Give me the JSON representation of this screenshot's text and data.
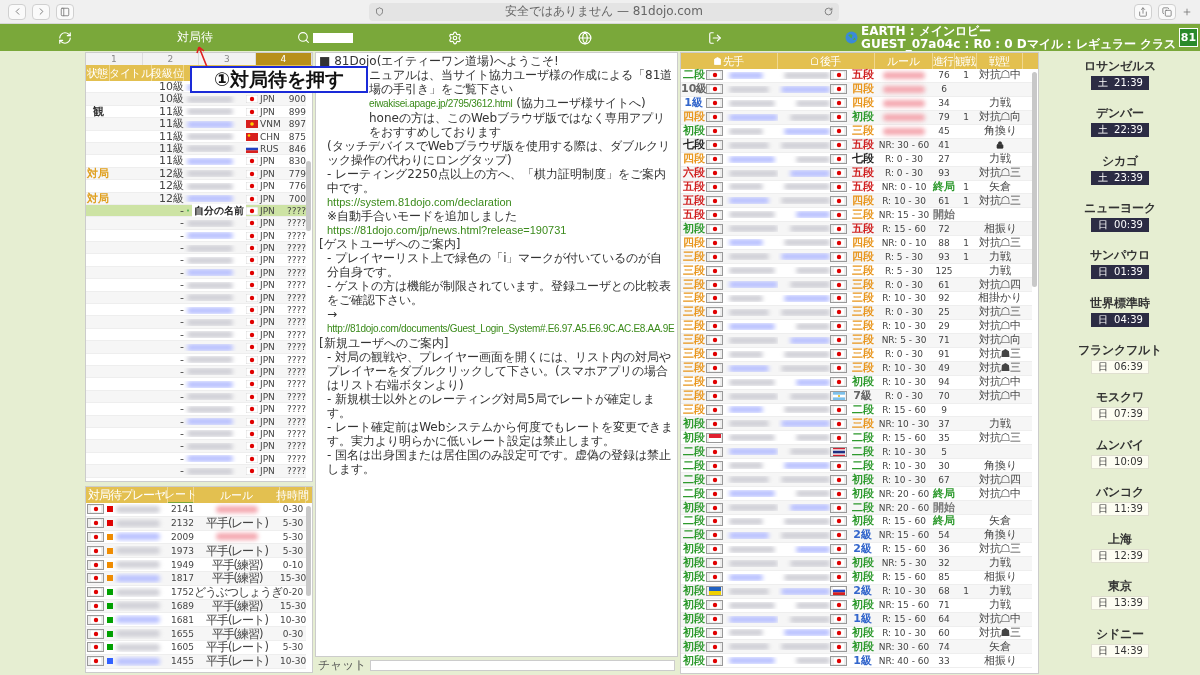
{
  "browser": {
    "address": "安全ではありません — 81dojo.com"
  },
  "nav": {
    "wait_label": "対局待",
    "lobby": "EARTH : メインロビー",
    "user": "GUEST_07a04c : R0 : 0 Dマイル : レギュラー クラス",
    "logo": "81"
  },
  "callout": {
    "text": "①対局待を押す"
  },
  "players": {
    "tabs": [
      {
        "label": "1",
        "selected": false
      },
      {
        "label": "2",
        "selected": false
      },
      {
        "label": "3",
        "selected": false
      },
      {
        "label": "4",
        "selected": true
      }
    ],
    "columns": [
      "状態",
      "タイトル",
      "段級位"
    ],
    "rows": [
      {
        "rank": "10級",
        "selected": false
      },
      {
        "rank": "10級",
        "flag": {
          "kind": "jp"
        },
        "country": "JPN",
        "rate": "900",
        "selected": false
      },
      {
        "status": {
          "text": "観",
          "color": "#333333"
        },
        "rank": "11級",
        "flag": {
          "kind": "jp"
        },
        "country": "JPN",
        "rate": "899",
        "selected": false
      },
      {
        "rank": "11級",
        "flag": {
          "kind": "vn"
        },
        "country": "VNM",
        "rate": "897",
        "selected": false
      },
      {
        "rank": "11級",
        "flag": {
          "kind": "cn"
        },
        "country": "CHN",
        "rate": "875",
        "selected": false
      },
      {
        "rank": "11級",
        "flag": {
          "kind": "ru"
        },
        "country": "RUS",
        "rate": "846",
        "selected": false
      },
      {
        "rank": "11級",
        "flag": {
          "kind": "jp"
        },
        "country": "JPN",
        "rate": "830",
        "selected": false
      },
      {
        "status": {
          "text": "対局",
          "color": "#e0a020"
        },
        "rank": "12級",
        "flag": {
          "kind": "jp"
        },
        "country": "JPN",
        "rate": "779",
        "selected": false
      },
      {
        "rank": "12級",
        "flag": {
          "kind": "jp"
        },
        "country": "JPN",
        "rate": "776",
        "selected": false
      },
      {
        "status": {
          "text": "対局",
          "color": "#e0a020"
        },
        "rank": "12級",
        "flag": {
          "kind": "jp"
        },
        "country": "JPN",
        "rate": "700",
        "selected": false
      },
      {
        "rank": "-",
        "name": "自分の名前",
        "flag": {
          "kind": "jp"
        },
        "country": "JPN",
        "rate": "????",
        "selected": true
      },
      {
        "rank": "-",
        "flag": {
          "kind": "jp"
        },
        "country": "JPN",
        "rate": "????",
        "selected": false
      },
      {
        "rank": "-",
        "flag": {
          "kind": "jp"
        },
        "country": "JPN",
        "rate": "????",
        "selected": false
      },
      {
        "rank": "-",
        "flag": {
          "kind": "jp"
        },
        "country": "JPN",
        "rate": "????",
        "selected": false
      },
      {
        "rank": "-",
        "flag": {
          "kind": "jp"
        },
        "country": "JPN",
        "rate": "????",
        "selected": false
      },
      {
        "rank": "-",
        "flag": {
          "kind": "jp"
        },
        "country": "JPN",
        "rate": "????",
        "selected": false
      },
      {
        "rank": "-",
        "flag": {
          "kind": "jp"
        },
        "country": "JPN",
        "rate": "????",
        "selected": false
      },
      {
        "rank": "-",
        "flag": {
          "kind": "jp"
        },
        "country": "JPN",
        "rate": "????",
        "selected": false
      },
      {
        "rank": "-",
        "flag": {
          "kind": "jp"
        },
        "country": "JPN",
        "rate": "????",
        "selected": false
      },
      {
        "rank": "-",
        "flag": {
          "kind": "jp"
        },
        "country": "JPN",
        "rate": "????",
        "selected": false
      },
      {
        "rank": "-",
        "flag": {
          "kind": "jp"
        },
        "country": "JPN",
        "rate": "????",
        "selected": false
      },
      {
        "rank": "-",
        "flag": {
          "kind": "jp"
        },
        "country": "JPN",
        "rate": "????",
        "selected": false
      },
      {
        "rank": "-",
        "flag": {
          "kind": "jp"
        },
        "country": "JPN",
        "rate": "????",
        "selected": false
      },
      {
        "rank": "-",
        "flag": {
          "kind": "jp"
        },
        "country": "JPN",
        "rate": "????",
        "selected": false
      },
      {
        "rank": "-",
        "flag": {
          "kind": "jp"
        },
        "country": "JPN",
        "rate": "????",
        "selected": false
      },
      {
        "rank": "-",
        "flag": {
          "kind": "jp"
        },
        "country": "JPN",
        "rate": "????",
        "selected": false
      },
      {
        "rank": "-",
        "flag": {
          "kind": "jp"
        },
        "country": "JPN",
        "rate": "????",
        "selected": false
      },
      {
        "rank": "-",
        "flag": {
          "kind": "jp"
        },
        "country": "JPN",
        "rate": "????",
        "selected": false
      },
      {
        "rank": "-",
        "flag": {
          "kind": "jp"
        },
        "country": "JPN",
        "rate": "????",
        "selected": false
      },
      {
        "rank": "-",
        "flag": {
          "kind": "jp"
        },
        "country": "JPN",
        "rate": "????",
        "selected": false
      },
      {
        "rank": "-",
        "flag": {
          "kind": "jp"
        },
        "country": "JPN",
        "rate": "????",
        "selected": false
      },
      {
        "rank": "-",
        "flag": {
          "kind": "jp"
        },
        "country": "JPN",
        "rate": "????",
        "selected": false
      }
    ]
  },
  "waiting": {
    "columns": [
      {
        "label": "対局待プレーヤ",
        "selected": false
      },
      {
        "label": "レート",
        "selected": true
      },
      {
        "label": "ルール",
        "selected": false
      },
      {
        "label": "持時間",
        "selected": false
      }
    ],
    "rows": [
      {
        "color": "#e00000",
        "rate": "2141",
        "rule_hidden": true,
        "time": "0-30"
      },
      {
        "color": "#e00000",
        "rate": "2132",
        "rule": "平手(レート)",
        "time": "5-30"
      },
      {
        "color": "#f08c00",
        "rate": "2009",
        "rule_hidden": true,
        "time": "5-30"
      },
      {
        "color": "#f08c00",
        "rate": "1973",
        "rule": "平手(レート)",
        "time": "5-30"
      },
      {
        "color": "#f08c00",
        "rate": "1949",
        "rule": "平手(練習)",
        "time": "0-10"
      },
      {
        "color": "#f08c00",
        "rate": "1817",
        "rule": "平手(練習)",
        "time": "15-30"
      },
      {
        "color": "#00a000",
        "rate": "1752",
        "rule": "どうぶつしょうぎ",
        "time": "0-20"
      },
      {
        "color": "#00a000",
        "rate": "1689",
        "rule": "平手(練習)",
        "time": "15-30"
      },
      {
        "color": "#00a000",
        "rate": "1681",
        "rule": "平手(レート)",
        "time": "10-30"
      },
      {
        "color": "#00a000",
        "rate": "1655",
        "rule": "平手(練習)",
        "time": "0-30"
      },
      {
        "color": "#00a000",
        "rate": "1605",
        "rule": "平手(レート)",
        "time": "5-30"
      },
      {
        "color": "#3060ff",
        "rate": "1455",
        "rule": "平手(レート)",
        "time": "10-30"
      }
    ]
  },
  "notice": {
    "lines": [
      {
        "kind": "full",
        "parts": [
          {
            "kind": "text",
            "text": "■ 81Dojo(エイティーワン道場)へようこそ!"
          }
        ]
      },
      {
        "kind": "partial",
        "parts": [
          {
            "kind": "text",
            "text": "ニュアルは、当サイト協力ユーザ様の作成による「81道場の手引き」をご覧下さい"
          }
        ]
      },
      {
        "kind": "partial",
        "parts": [
          {
            "kind": "link",
            "text": "eiwakisei.apage.jp/2795/3612.html"
          },
          {
            "kind": "text",
            "text": " (協力ユーザ様サイトへ)"
          }
        ]
      },
      {
        "kind": "partial",
        "parts": [
          {
            "kind": "text",
            "text": "honeの方は、このWebブラウザ版ではなく専用アプリをおすすめしております"
          }
        ]
      },
      {
        "kind": "indent",
        "parts": [
          {
            "kind": "text",
            "text": "(タッチデバイスでWebブラウザ版を使用する際は、ダブルクリック操作の代わりにロングタップ)"
          }
        ]
      },
      {
        "kind": "indent",
        "parts": [
          {
            "kind": "text",
            "text": "- レーティング2250点以上の方へ、「棋力証明制度」をご案内中です。"
          }
        ]
      },
      {
        "kind": "indent",
        "parts": [
          {
            "kind": "link",
            "text": "https://system.81dojo.com/declaration"
          }
        ]
      },
      {
        "kind": "indent",
        "parts": [
          {
            "kind": "text",
            "text": "※自動手合いモードを追加しました"
          }
        ]
      },
      {
        "kind": "indent",
        "parts": [
          {
            "kind": "link",
            "text": "https://81dojo.com/jp/news.html?release=190731"
          }
        ]
      },
      {
        "kind": "full",
        "parts": [
          {
            "kind": "text",
            "text": "[ゲストユーザへのご案内]"
          }
        ]
      },
      {
        "kind": "indent",
        "parts": [
          {
            "kind": "text",
            "text": "- プレイヤーリスト上で緑色の「i」マークが付いているのが自分自身です。"
          }
        ]
      },
      {
        "kind": "indent",
        "parts": [
          {
            "kind": "text",
            "text": "- ゲストの方は機能が制限されています。登録ユーザとの比較表をご確認下さい。"
          }
        ]
      },
      {
        "kind": "indent",
        "parts": [
          {
            "kind": "text",
            "text": "→ "
          },
          {
            "kind": "link",
            "text": "http://81dojo.com/documents/Guest_Login_System#.E6.97.A5.E6.9C.AC.E8.AA.9E"
          }
        ]
      },
      {
        "kind": "full",
        "parts": [
          {
            "kind": "text",
            "text": "[新規ユーザへのご案内]"
          }
        ]
      },
      {
        "kind": "indent",
        "parts": [
          {
            "kind": "text",
            "text": "- 対局の観戦や、プレイヤー画面を開くには、リスト内の対局やプレイヤーをダブルクリックして下さい。(スマホアプリの場合はリスト右端ボタンより)"
          }
        ]
      },
      {
        "kind": "indent",
        "parts": [
          {
            "kind": "text",
            "text": "- 新規棋士以外とのレーティング対局5局でレートが確定します。"
          }
        ]
      },
      {
        "kind": "indent",
        "parts": [
          {
            "kind": "text",
            "text": "- レート確定前はWebシステムから何度でもレートを変更できます。実力より明らかに低いレート設定は禁止します。"
          }
        ]
      },
      {
        "kind": "indent",
        "parts": [
          {
            "kind": "text",
            "text": "- 国名は出身国または居住国のみ設定可です。虚偽の登録は禁止します。"
          }
        ]
      }
    ],
    "chat_label": "チャット"
  },
  "games": {
    "columns": [
      "先手",
      "後手",
      "ルール",
      "進行",
      "観戦",
      "戦型"
    ],
    "rows": [
      {
        "black": {
          "rank": "二段",
          "color": "#2e9a2e"
        },
        "white": {
          "rank": "五段",
          "color": "#d02020"
        },
        "rule_hidden": true,
        "moves": "76",
        "watchers": "1",
        "opening": "対抗☖中"
      },
      {
        "black": {
          "rank": "10級",
          "color": "#666666"
        },
        "white": {
          "rank": "四段",
          "color": "#e8961e"
        },
        "rule_hidden": true,
        "moves": "6"
      },
      {
        "black": {
          "rank": "1級",
          "color": "#3366cc"
        },
        "white": {
          "rank": "四段",
          "color": "#e8961e"
        },
        "rule_hidden": true,
        "moves": "34",
        "opening": "力戦"
      },
      {
        "black": {
          "rank": "四段",
          "color": "#e8961e"
        },
        "white": {
          "rank": "初段",
          "color": "#2e9a2e"
        },
        "rule_hidden": true,
        "moves": "79",
        "watchers": "1",
        "opening": "対抗☖向"
      },
      {
        "black": {
          "rank": "初段",
          "color": "#2e9a2e"
        },
        "white": {
          "rank": "三段",
          "color": "#e8961e"
        },
        "rule_hidden": true,
        "moves": "45",
        "opening": "角換り"
      },
      {
        "black": {
          "rank": "七段",
          "color": "#222222"
        },
        "white": {
          "rank": "五段",
          "color": "#d02020"
        },
        "rule": "NR: 30 - 60",
        "moves": "41",
        "locked": true
      },
      {
        "black": {
          "rank": "四段",
          "color": "#e8961e"
        },
        "white": {
          "rank": "七段",
          "color": "#222222"
        },
        "rule": "R: 0 - 30",
        "moves": "27",
        "opening": "力戦"
      },
      {
        "black": {
          "rank": "六段",
          "color": "#d02020"
        },
        "white": {
          "rank": "五段",
          "color": "#d02020"
        },
        "rule": "R: 0 - 30",
        "moves": "93",
        "opening": "対抗☖三"
      },
      {
        "black": {
          "rank": "五段",
          "color": "#d02020"
        },
        "white": {
          "rank": "五段",
          "color": "#d02020"
        },
        "rule": "NR: 0 - 10",
        "moves": {
          "text": "終局",
          "color": "#2e9a2e"
        },
        "watchers": "1",
        "opening": "矢倉"
      },
      {
        "black": {
          "rank": "五段",
          "color": "#d02020"
        },
        "white": {
          "rank": "四段",
          "color": "#e8961e"
        },
        "rule": "R: 10 - 30",
        "moves": "61",
        "watchers": "1",
        "opening": "対抗☖三"
      },
      {
        "black": {
          "rank": "五段",
          "color": "#d02020"
        },
        "white": {
          "rank": "三段",
          "color": "#e8961e"
        },
        "rule": "NR: 15 - 30",
        "moves": {
          "text": "開始",
          "color": "#777777"
        }
      },
      {
        "black": {
          "rank": "初段",
          "color": "#2e9a2e"
        },
        "white": {
          "rank": "五段",
          "color": "#d02020"
        },
        "rule": "R: 15 - 60",
        "moves": "72",
        "opening": "相振り"
      },
      {
        "black": {
          "rank": "四段",
          "color": "#e8961e"
        },
        "white": {
          "rank": "四段",
          "color": "#e8961e"
        },
        "rule": "NR: 0 - 10",
        "moves": "88",
        "watchers": "1",
        "opening": "対抗☖三"
      },
      {
        "black": {
          "rank": "三段",
          "color": "#e8961e"
        },
        "white": {
          "rank": "四段",
          "color": "#e8961e"
        },
        "rule": "R: 5 - 30",
        "moves": "93",
        "watchers": "1",
        "opening": "力戦"
      },
      {
        "black": {
          "rank": "三段",
          "color": "#e8961e"
        },
        "white": {
          "rank": "三段",
          "color": "#e8961e"
        },
        "rule": "R: 5 - 30",
        "moves": "125",
        "opening": "力戦"
      },
      {
        "black": {
          "rank": "三段",
          "color": "#e8961e"
        },
        "white": {
          "rank": "三段",
          "color": "#e8961e"
        },
        "rule": "R: 0 - 30",
        "moves": "61",
        "opening": "対抗☖四"
      },
      {
        "black": {
          "rank": "三段",
          "color": "#e8961e"
        },
        "white": {
          "rank": "三段",
          "color": "#e8961e"
        },
        "rule": "R: 10 - 30",
        "moves": "92",
        "opening": "相掛かり"
      },
      {
        "black": {
          "rank": "三段",
          "color": "#e8961e"
        },
        "white": {
          "rank": "三段",
          "color": "#e8961e"
        },
        "rule": "R: 0 - 30",
        "moves": "25",
        "opening": "対抗☖三"
      },
      {
        "black": {
          "rank": "三段",
          "color": "#e8961e"
        },
        "white": {
          "rank": "三段",
          "color": "#e8961e"
        },
        "rule": "R: 10 - 30",
        "moves": "29",
        "opening": "対抗☖中"
      },
      {
        "black": {
          "rank": "三段",
          "color": "#e8961e"
        },
        "white": {
          "rank": "三段",
          "color": "#e8961e"
        },
        "rule": "NR: 5 - 30",
        "moves": "71",
        "opening": "対抗☖向"
      },
      {
        "black": {
          "rank": "三段",
          "color": "#e8961e"
        },
        "white": {
          "rank": "三段",
          "color": "#e8961e"
        },
        "rule": "R: 0 - 30",
        "moves": "91",
        "opening": "対抗☗三"
      },
      {
        "black": {
          "rank": "三段",
          "color": "#e8961e"
        },
        "white": {
          "rank": "三段",
          "color": "#e8961e"
        },
        "rule": "R: 10 - 30",
        "moves": "49",
        "opening": "対抗☗三"
      },
      {
        "black": {
          "rank": "三段",
          "color": "#e8961e"
        },
        "white": {
          "rank": "初段",
          "color": "#2e9a2e"
        },
        "rule": "R: 10 - 30",
        "moves": "94",
        "opening": "対抗☖中"
      },
      {
        "black": {
          "rank": "三段",
          "color": "#e8961e"
        },
        "white": {
          "rank": "7級",
          "color": "#666666",
          "flag": {
            "kind": "ar"
          }
        },
        "rule": "R: 0 - 30",
        "moves": "70",
        "opening": "対抗☖中"
      },
      {
        "black": {
          "rank": "三段",
          "color": "#e8961e"
        },
        "white": {
          "rank": "二段",
          "color": "#2e9a2e"
        },
        "rule": "R: 15 - 60",
        "moves": "9"
      },
      {
        "black": {
          "rank": "初段",
          "color": "#2e9a2e"
        },
        "white": {
          "rank": "三段",
          "color": "#e8961e"
        },
        "rule": "NR: 10 - 30",
        "moves": "37",
        "opening": "力戦"
      },
      {
        "black": {
          "rank": "初段",
          "color": "#2e9a2e",
          "flag": {
            "kind": "sg"
          }
        },
        "white": {
          "rank": "二段",
          "color": "#2e9a2e"
        },
        "rule": "R: 15 - 60",
        "moves": "35",
        "opening": "対抗☖三"
      },
      {
        "black": {
          "rank": "二段",
          "color": "#2e9a2e"
        },
        "white": {
          "rank": "二段",
          "color": "#2e9a2e",
          "flag": {
            "kind": "th"
          }
        },
        "rule": "R: 10 - 30",
        "moves": "5"
      },
      {
        "black": {
          "rank": "二段",
          "color": "#2e9a2e"
        },
        "white": {
          "rank": "二段",
          "color": "#2e9a2e"
        },
        "rule": "R: 10 - 30",
        "moves": "30",
        "opening": "角換り"
      },
      {
        "black": {
          "rank": "二段",
          "color": "#2e9a2e"
        },
        "white": {
          "rank": "初段",
          "color": "#2e9a2e"
        },
        "rule": "R: 10 - 30",
        "moves": "67",
        "opening": "対抗☖四"
      },
      {
        "black": {
          "rank": "二段",
          "color": "#2e9a2e"
        },
        "white": {
          "rank": "初段",
          "color": "#2e9a2e"
        },
        "rule": "NR: 20 - 60",
        "moves": {
          "text": "終局",
          "color": "#2e9a2e"
        },
        "opening": "対抗☖中"
      },
      {
        "black": {
          "rank": "初段",
          "color": "#2e9a2e"
        },
        "white": {
          "rank": "二段",
          "color": "#2e9a2e"
        },
        "rule": "NR: 20 - 60",
        "moves": {
          "text": "開始",
          "color": "#777777"
        }
      },
      {
        "black": {
          "rank": "二段",
          "color": "#2e9a2e"
        },
        "white": {
          "rank": "初段",
          "color": "#2e9a2e"
        },
        "rule": "R: 15 - 60",
        "moves": {
          "text": "終局",
          "color": "#2e9a2e"
        },
        "opening": "矢倉"
      },
      {
        "black": {
          "rank": "二段",
          "color": "#2e9a2e"
        },
        "white": {
          "rank": "2級",
          "color": "#3366cc"
        },
        "rule": "NR: 15 - 60",
        "moves": "54",
        "opening": "角換り"
      },
      {
        "black": {
          "rank": "初段",
          "color": "#2e9a2e"
        },
        "white": {
          "rank": "2級",
          "color": "#3366cc"
        },
        "rule": "R: 15 - 60",
        "moves": "36",
        "opening": "対抗☖三"
      },
      {
        "black": {
          "rank": "初段",
          "color": "#2e9a2e"
        },
        "white": {
          "rank": "初段",
          "color": "#2e9a2e"
        },
        "rule": "NR: 5 - 30",
        "moves": "32",
        "opening": "力戦"
      },
      {
        "black": {
          "rank": "初段",
          "color": "#2e9a2e"
        },
        "white": {
          "rank": "初段",
          "color": "#2e9a2e"
        },
        "rule": "R: 15 - 60",
        "moves": "85",
        "opening": "相振り"
      },
      {
        "black": {
          "rank": "初段",
          "color": "#2e9a2e",
          "flag": {
            "kind": "ua"
          }
        },
        "white": {
          "rank": "2級",
          "color": "#3366cc",
          "flag": {
            "kind": "ru"
          }
        },
        "rule": "R: 10 - 30",
        "moves": "68",
        "watchers": "1",
        "opening": "力戦"
      },
      {
        "black": {
          "rank": "初段",
          "color": "#2e9a2e"
        },
        "white": {
          "rank": "初段",
          "color": "#2e9a2e"
        },
        "rule": "NR: 15 - 60",
        "moves": "71",
        "opening": "力戦"
      },
      {
        "black": {
          "rank": "初段",
          "color": "#2e9a2e"
        },
        "white": {
          "rank": "1級",
          "color": "#3366cc"
        },
        "rule": "R: 15 - 60",
        "moves": "64",
        "opening": "対抗☖中"
      },
      {
        "black": {
          "rank": "初段",
          "color": "#2e9a2e"
        },
        "white": {
          "rank": "初段",
          "color": "#2e9a2e"
        },
        "rule": "R: 10 - 30",
        "moves": "60",
        "opening": "対抗☗三"
      },
      {
        "black": {
          "rank": "初段",
          "color": "#2e9a2e"
        },
        "white": {
          "rank": "初段",
          "color": "#2e9a2e"
        },
        "rule": "NR: 30 - 60",
        "moves": "74",
        "opening": "矢倉"
      },
      {
        "black": {
          "rank": "初段",
          "color": "#2e9a2e"
        },
        "white": {
          "rank": "1級",
          "color": "#3366cc"
        },
        "rule": "NR: 40 - 60",
        "moves": "33",
        "opening": "相振り"
      }
    ]
  },
  "clocks": [
    {
      "city": "ロサンゼルス",
      "day": "土",
      "time": "21:39",
      "night": true
    },
    {
      "city": "デンバー",
      "day": "土",
      "time": "22:39",
      "night": true
    },
    {
      "city": "シカゴ",
      "day": "土",
      "time": "23:39",
      "night": true
    },
    {
      "city": "ニューヨーク",
      "day": "日",
      "time": "00:39",
      "night": true
    },
    {
      "city": "サンパウロ",
      "day": "日",
      "time": "01:39",
      "night": true
    },
    {
      "city": "世界標準時",
      "day": "日",
      "time": "04:39",
      "night": true
    },
    {
      "city": "フランクフルト",
      "day": "日",
      "time": "06:39",
      "night": false
    },
    {
      "city": "モスクワ",
      "day": "日",
      "time": "07:39",
      "night": false
    },
    {
      "city": "ムンバイ",
      "day": "日",
      "time": "10:09",
      "night": false
    },
    {
      "city": "バンコク",
      "day": "日",
      "time": "11:39",
      "night": false
    },
    {
      "city": "上海",
      "day": "日",
      "time": "12:39",
      "night": false
    },
    {
      "city": "東京",
      "day": "日",
      "time": "13:39",
      "night": false
    },
    {
      "city": "シドニー",
      "day": "日",
      "time": "14:39",
      "night": false
    }
  ]
}
